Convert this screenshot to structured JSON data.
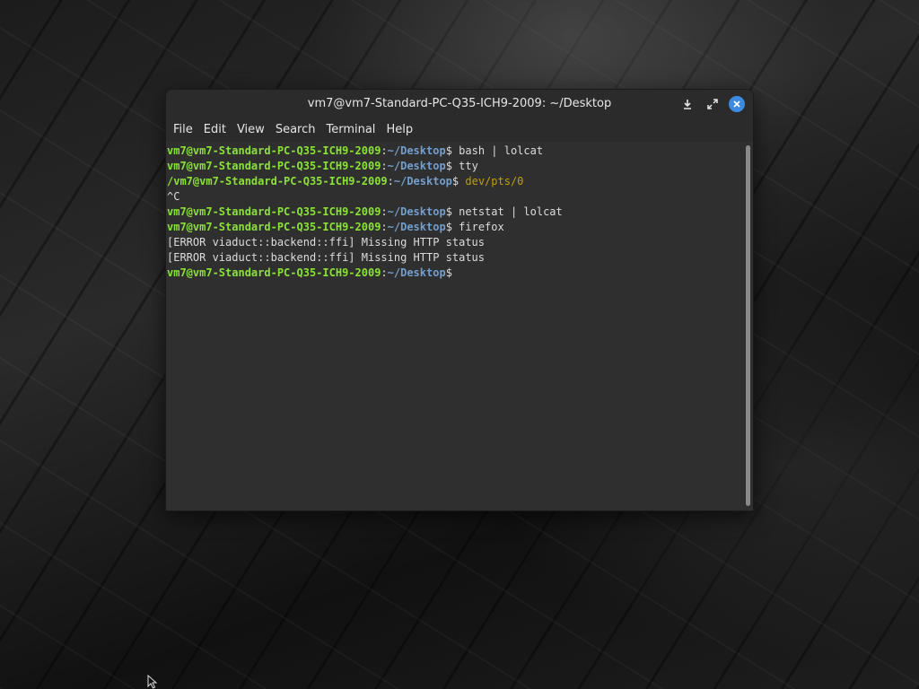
{
  "window": {
    "title": "vm7@vm7-Standard-PC-Q35-ICH9-2009: ~/Desktop",
    "buttons": {
      "download_icon": "download-icon",
      "maximize_icon": "maximize-icon",
      "close_icon": "close-icon"
    }
  },
  "menu": {
    "items": [
      "File",
      "Edit",
      "View",
      "Search",
      "Terminal",
      "Help"
    ]
  },
  "terminal": {
    "lines": [
      {
        "user": "vm7@vm7-Standard-PC-Q35-ICH9-2009",
        "colon": ":",
        "path": "~/Desktop",
        "sym": "$",
        "cmd": " bash | lolcat"
      },
      {
        "user": "vm7@vm7-Standard-PC-Q35-ICH9-2009",
        "colon": ":",
        "path": "~/Desktop",
        "sym": "$",
        "cmd": " tty"
      },
      {
        "user": "/vm7@vm7-Standard-PC-Q35-ICH9-2009",
        "colon": ":",
        "path": "~/Desktop",
        "sym": "$",
        "cmd": " dev/pts/0"
      },
      {
        "text": "^C"
      },
      {
        "user": "vm7@vm7-Standard-PC-Q35-ICH9-2009",
        "colon": ":",
        "path": "~/Desktop",
        "sym": "$",
        "cmd": " netstat | lolcat"
      },
      {
        "user": "vm7@vm7-Standard-PC-Q35-ICH9-2009",
        "colon": ":",
        "path": "~/Desktop",
        "sym": "$",
        "cmd": " firefox"
      },
      {
        "text": "[ERROR viaduct::backend::ffi] Missing HTTP status"
      },
      {
        "text": "[ERROR viaduct::backend::ffi] Missing HTTP status"
      },
      {
        "user": "vm7@vm7-Standard-PC-Q35-ICH9-2009",
        "colon": ":",
        "path": "~/Desktop",
        "sym": "$",
        "cmd": ""
      }
    ]
  },
  "colors": {
    "user": "#8ae234",
    "path": "#729fcf",
    "rainbow_line": "#c4a000",
    "background": "#2f2f2f",
    "close_button": "#3d8be0"
  }
}
